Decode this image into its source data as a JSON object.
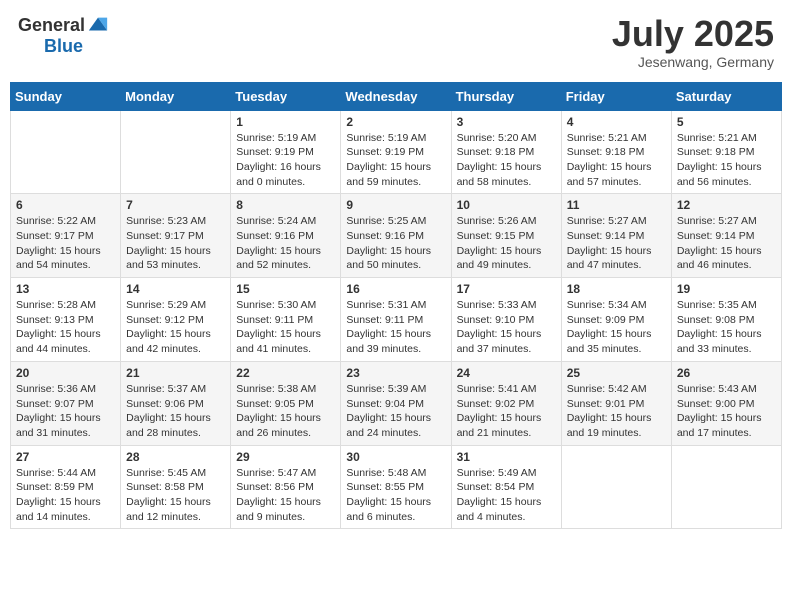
{
  "header": {
    "logo_general": "General",
    "logo_blue": "Blue",
    "month_title": "July 2025",
    "location": "Jesenwang, Germany"
  },
  "days_of_week": [
    "Sunday",
    "Monday",
    "Tuesday",
    "Wednesday",
    "Thursday",
    "Friday",
    "Saturday"
  ],
  "weeks": [
    [
      {
        "day": "",
        "sunrise": "",
        "sunset": "",
        "daylight": ""
      },
      {
        "day": "",
        "sunrise": "",
        "sunset": "",
        "daylight": ""
      },
      {
        "day": "1",
        "sunrise": "Sunrise: 5:19 AM",
        "sunset": "Sunset: 9:19 PM",
        "daylight": "Daylight: 16 hours and 0 minutes."
      },
      {
        "day": "2",
        "sunrise": "Sunrise: 5:19 AM",
        "sunset": "Sunset: 9:19 PM",
        "daylight": "Daylight: 15 hours and 59 minutes."
      },
      {
        "day": "3",
        "sunrise": "Sunrise: 5:20 AM",
        "sunset": "Sunset: 9:18 PM",
        "daylight": "Daylight: 15 hours and 58 minutes."
      },
      {
        "day": "4",
        "sunrise": "Sunrise: 5:21 AM",
        "sunset": "Sunset: 9:18 PM",
        "daylight": "Daylight: 15 hours and 57 minutes."
      },
      {
        "day": "5",
        "sunrise": "Sunrise: 5:21 AM",
        "sunset": "Sunset: 9:18 PM",
        "daylight": "Daylight: 15 hours and 56 minutes."
      }
    ],
    [
      {
        "day": "6",
        "sunrise": "Sunrise: 5:22 AM",
        "sunset": "Sunset: 9:17 PM",
        "daylight": "Daylight: 15 hours and 54 minutes."
      },
      {
        "day": "7",
        "sunrise": "Sunrise: 5:23 AM",
        "sunset": "Sunset: 9:17 PM",
        "daylight": "Daylight: 15 hours and 53 minutes."
      },
      {
        "day": "8",
        "sunrise": "Sunrise: 5:24 AM",
        "sunset": "Sunset: 9:16 PM",
        "daylight": "Daylight: 15 hours and 52 minutes."
      },
      {
        "day": "9",
        "sunrise": "Sunrise: 5:25 AM",
        "sunset": "Sunset: 9:16 PM",
        "daylight": "Daylight: 15 hours and 50 minutes."
      },
      {
        "day": "10",
        "sunrise": "Sunrise: 5:26 AM",
        "sunset": "Sunset: 9:15 PM",
        "daylight": "Daylight: 15 hours and 49 minutes."
      },
      {
        "day": "11",
        "sunrise": "Sunrise: 5:27 AM",
        "sunset": "Sunset: 9:14 PM",
        "daylight": "Daylight: 15 hours and 47 minutes."
      },
      {
        "day": "12",
        "sunrise": "Sunrise: 5:27 AM",
        "sunset": "Sunset: 9:14 PM",
        "daylight": "Daylight: 15 hours and 46 minutes."
      }
    ],
    [
      {
        "day": "13",
        "sunrise": "Sunrise: 5:28 AM",
        "sunset": "Sunset: 9:13 PM",
        "daylight": "Daylight: 15 hours and 44 minutes."
      },
      {
        "day": "14",
        "sunrise": "Sunrise: 5:29 AM",
        "sunset": "Sunset: 9:12 PM",
        "daylight": "Daylight: 15 hours and 42 minutes."
      },
      {
        "day": "15",
        "sunrise": "Sunrise: 5:30 AM",
        "sunset": "Sunset: 9:11 PM",
        "daylight": "Daylight: 15 hours and 41 minutes."
      },
      {
        "day": "16",
        "sunrise": "Sunrise: 5:31 AM",
        "sunset": "Sunset: 9:11 PM",
        "daylight": "Daylight: 15 hours and 39 minutes."
      },
      {
        "day": "17",
        "sunrise": "Sunrise: 5:33 AM",
        "sunset": "Sunset: 9:10 PM",
        "daylight": "Daylight: 15 hours and 37 minutes."
      },
      {
        "day": "18",
        "sunrise": "Sunrise: 5:34 AM",
        "sunset": "Sunset: 9:09 PM",
        "daylight": "Daylight: 15 hours and 35 minutes."
      },
      {
        "day": "19",
        "sunrise": "Sunrise: 5:35 AM",
        "sunset": "Sunset: 9:08 PM",
        "daylight": "Daylight: 15 hours and 33 minutes."
      }
    ],
    [
      {
        "day": "20",
        "sunrise": "Sunrise: 5:36 AM",
        "sunset": "Sunset: 9:07 PM",
        "daylight": "Daylight: 15 hours and 31 minutes."
      },
      {
        "day": "21",
        "sunrise": "Sunrise: 5:37 AM",
        "sunset": "Sunset: 9:06 PM",
        "daylight": "Daylight: 15 hours and 28 minutes."
      },
      {
        "day": "22",
        "sunrise": "Sunrise: 5:38 AM",
        "sunset": "Sunset: 9:05 PM",
        "daylight": "Daylight: 15 hours and 26 minutes."
      },
      {
        "day": "23",
        "sunrise": "Sunrise: 5:39 AM",
        "sunset": "Sunset: 9:04 PM",
        "daylight": "Daylight: 15 hours and 24 minutes."
      },
      {
        "day": "24",
        "sunrise": "Sunrise: 5:41 AM",
        "sunset": "Sunset: 9:02 PM",
        "daylight": "Daylight: 15 hours and 21 minutes."
      },
      {
        "day": "25",
        "sunrise": "Sunrise: 5:42 AM",
        "sunset": "Sunset: 9:01 PM",
        "daylight": "Daylight: 15 hours and 19 minutes."
      },
      {
        "day": "26",
        "sunrise": "Sunrise: 5:43 AM",
        "sunset": "Sunset: 9:00 PM",
        "daylight": "Daylight: 15 hours and 17 minutes."
      }
    ],
    [
      {
        "day": "27",
        "sunrise": "Sunrise: 5:44 AM",
        "sunset": "Sunset: 8:59 PM",
        "daylight": "Daylight: 15 hours and 14 minutes."
      },
      {
        "day": "28",
        "sunrise": "Sunrise: 5:45 AM",
        "sunset": "Sunset: 8:58 PM",
        "daylight": "Daylight: 15 hours and 12 minutes."
      },
      {
        "day": "29",
        "sunrise": "Sunrise: 5:47 AM",
        "sunset": "Sunset: 8:56 PM",
        "daylight": "Daylight: 15 hours and 9 minutes."
      },
      {
        "day": "30",
        "sunrise": "Sunrise: 5:48 AM",
        "sunset": "Sunset: 8:55 PM",
        "daylight": "Daylight: 15 hours and 6 minutes."
      },
      {
        "day": "31",
        "sunrise": "Sunrise: 5:49 AM",
        "sunset": "Sunset: 8:54 PM",
        "daylight": "Daylight: 15 hours and 4 minutes."
      },
      {
        "day": "",
        "sunrise": "",
        "sunset": "",
        "daylight": ""
      },
      {
        "day": "",
        "sunrise": "",
        "sunset": "",
        "daylight": ""
      }
    ]
  ]
}
